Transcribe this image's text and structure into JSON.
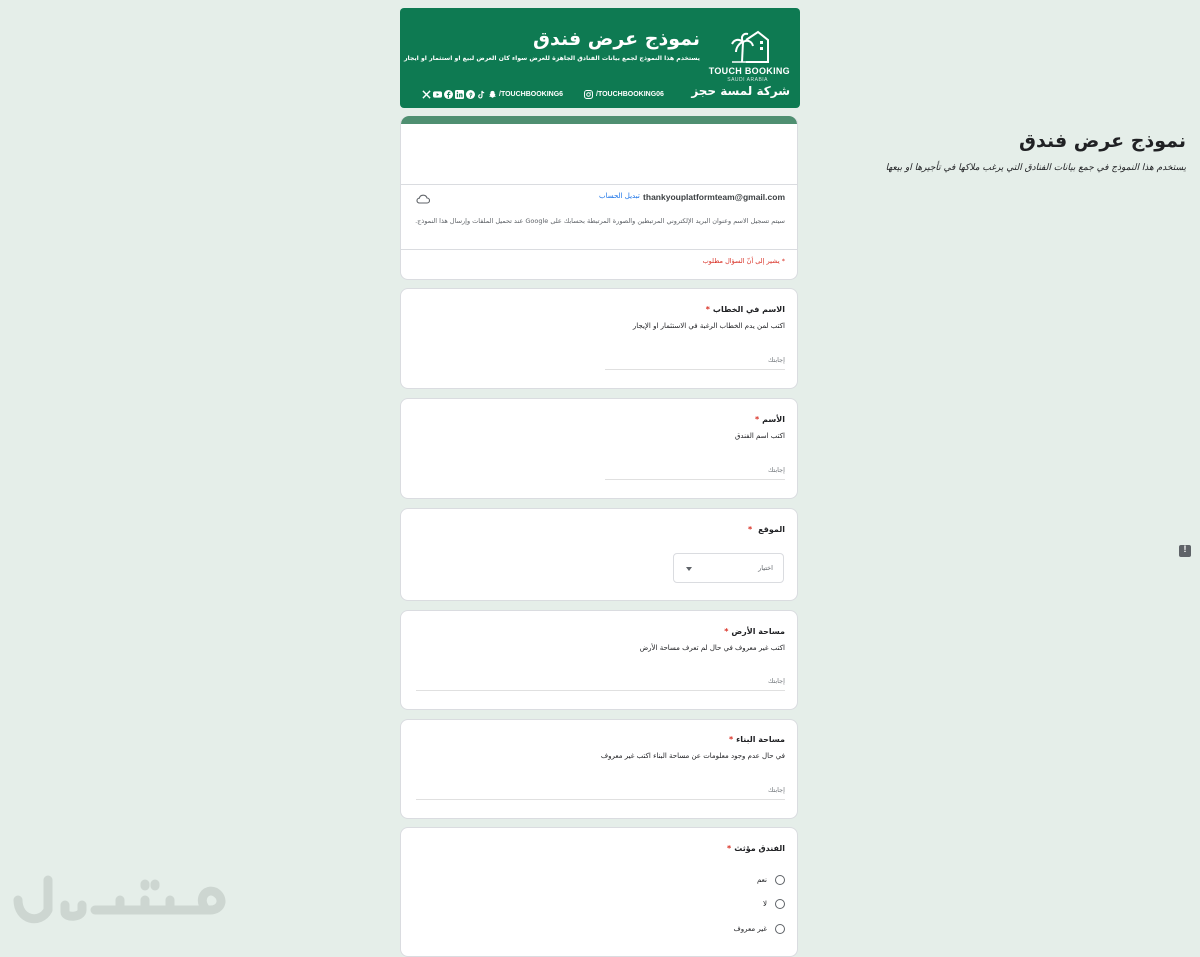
{
  "banner": {
    "brand_en": "TOUCH BOOKING",
    "brand_sub": "SAUDI ARABIA",
    "brand_ar": "شركة لمسة حجز",
    "title": "نموذج عرض فندق",
    "subtitle": "يستخدم هذا النموذج لجمع بيانات الفنادق الجاهزة للعرض سواء كان العرض لبيع او استثمار او ايجار",
    "social_handle": "/TOUCHBOOKING6",
    "instagram_handle": "/TOUCHBOOKING06",
    "social_icons": [
      "x-icon",
      "youtube-icon",
      "facebook-icon",
      "linkedin-icon",
      "pinterest-icon",
      "tiktok-icon",
      "snapchat-icon"
    ]
  },
  "header": {
    "title": "نموذج عرض فندق",
    "description": "يستخدم هذا النموذج في جمع بيانات الفنادق التي يرغب ملاكها في تأجيرها او بيعها",
    "email": "thankyouplatformteam@gmail.com",
    "switch_account": "تبديل الحساب",
    "notice": "سيتم تسجيل الاسم وعنوان البريد الإلكتروني المرتبطين والصورة المرتبطة بحسابك على Google عند تحميل الملفات وإرسال هذا النموذج.",
    "required_note": "* يشير إلى أنّ السؤال مطلوب"
  },
  "questions": {
    "q1": {
      "title": "الاسم في الخطاب",
      "hint": "اكتب لمن يدم الخطاب الرغبة في الاستثمار او الإيجار",
      "answer_placeholder": "إجابتك"
    },
    "q2": {
      "title": "الأسم",
      "hint": "اكتب اسم الفندق",
      "answer_placeholder": "إجابتك"
    },
    "q3": {
      "title": "الموقع",
      "select_label": "اختيار"
    },
    "q4": {
      "title": "مساحة الأرض",
      "hint": "اكتب غير معروف في حال لم تعرف مساحة الأرض",
      "answer_placeholder": "إجابتك"
    },
    "q5": {
      "title": "مساحة البناء",
      "hint": "في حال عدم وجود معلومات عن مساحة البناء اكتب غير معروف",
      "answer_placeholder": "إجابتك"
    },
    "q6": {
      "title": "الفندق مؤثث",
      "options": [
        "نعم",
        "لا",
        "غير معروف"
      ]
    }
  },
  "required_star": "*",
  "colors": {
    "banner": "#0e7a52",
    "accent": "#4f8f71",
    "required": "#d93025",
    "link": "#1a73e8",
    "background": "#e5eee9"
  }
}
